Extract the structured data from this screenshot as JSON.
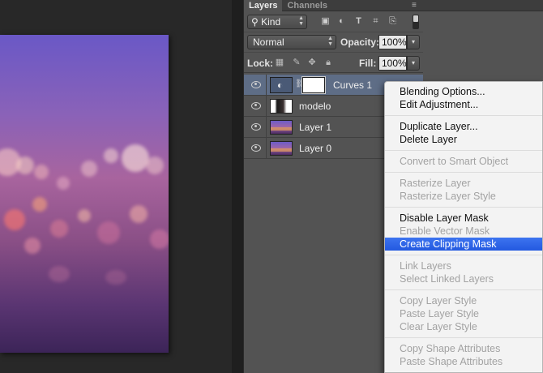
{
  "panel": {
    "tabs": [
      {
        "label": "Layers",
        "active": true
      },
      {
        "label": "Channels",
        "active": false
      }
    ],
    "menu_icon": "≡",
    "filter": {
      "kind_label": "Kind"
    },
    "blend_mode": "Normal",
    "opacity_label": "Opacity:",
    "opacity_value": "100%",
    "lock_label": "Lock:",
    "fill_label": "Fill:",
    "fill_value": "100%"
  },
  "layers": [
    {
      "name": "Curves 1",
      "type": "adjustment",
      "selected": true,
      "visible": true
    },
    {
      "name": "modelo",
      "type": "image",
      "selected": false,
      "visible": true
    },
    {
      "name": "Layer 1",
      "type": "image",
      "selected": false,
      "visible": true
    },
    {
      "name": "Layer 0",
      "type": "image",
      "selected": false,
      "visible": true
    }
  ],
  "context_menu": {
    "groups": [
      [
        {
          "label": "Blending Options...",
          "enabled": true
        },
        {
          "label": "Edit Adjustment...",
          "enabled": true
        }
      ],
      [
        {
          "label": "Duplicate Layer...",
          "enabled": true
        },
        {
          "label": "Delete Layer",
          "enabled": true
        }
      ],
      [
        {
          "label": "Convert to Smart Object",
          "enabled": false
        }
      ],
      [
        {
          "label": "Rasterize Layer",
          "enabled": false
        },
        {
          "label": "Rasterize Layer Style",
          "enabled": false
        }
      ],
      [
        {
          "label": "Disable Layer Mask",
          "enabled": true
        },
        {
          "label": "Enable Vector Mask",
          "enabled": false
        },
        {
          "label": "Create Clipping Mask",
          "enabled": true,
          "highlighted": true
        }
      ],
      [
        {
          "label": "Link Layers",
          "enabled": false
        },
        {
          "label": "Select Linked Layers",
          "enabled": false
        }
      ],
      [
        {
          "label": "Copy Layer Style",
          "enabled": false
        },
        {
          "label": "Paste Layer Style",
          "enabled": false
        },
        {
          "label": "Clear Layer Style",
          "enabled": false
        }
      ],
      [
        {
          "label": "Copy Shape Attributes",
          "enabled": false
        },
        {
          "label": "Paste Shape Attributes",
          "enabled": false
        }
      ]
    ]
  },
  "colors": {
    "panel_bg": "#535353",
    "selected_layer": "#5e6d86",
    "menu_highlight": "#2f66e8"
  }
}
